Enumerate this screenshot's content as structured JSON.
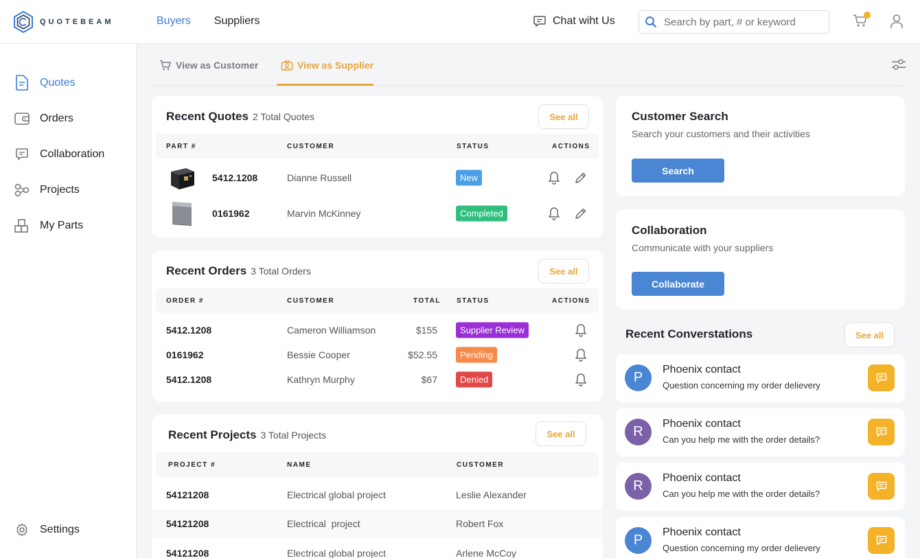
{
  "brand": {
    "name": "QUOTEBEAM"
  },
  "topnav": {
    "buyers": "Buyers",
    "suppliers": "Suppliers"
  },
  "chat": {
    "label": "Chat wiht Us"
  },
  "search": {
    "placeholder": "Search by part, # or keyword"
  },
  "sidebar": {
    "items": [
      {
        "label": "Quotes",
        "icon": "quote-document-icon",
        "active": true
      },
      {
        "label": "Orders",
        "icon": "wallet-icon"
      },
      {
        "label": "Collaboration",
        "icon": "chat-bubble-icon"
      },
      {
        "label": "Projects",
        "icon": "projects-icon"
      },
      {
        "label": "My Parts",
        "icon": "parts-icon"
      }
    ],
    "settings": "Settings"
  },
  "subtabs": {
    "customer": "View as Customer",
    "supplier": "View as Supplier"
  },
  "colors": {
    "accent": "#3f7bd0",
    "orange": "#e8a53b",
    "new": "#4a9fe6",
    "completed": "#2fbf7d",
    "supplier_review": "#9b2fd6",
    "pending": "#f58a4b",
    "denied": "#e04848"
  },
  "quotes": {
    "title": "Recent Quotes",
    "count": "2 Total Quotes",
    "see_all": "See all",
    "headers": {
      "part": "PART #",
      "customer": "CUSTOMER",
      "status": "STATUS",
      "actions": "ACTIONS"
    },
    "rows": [
      {
        "part": "5412.1208",
        "customer": "Dianne Russell",
        "status": "New"
      },
      {
        "part": "0161962",
        "customer": "Marvin McKinney",
        "status": "Completed"
      }
    ]
  },
  "orders": {
    "title": "Recent Orders",
    "count": "3 Total Orders",
    "see_all": "See all",
    "headers": {
      "order": "ORDER #",
      "customer": "CUSTOMER",
      "total": "TOTAL",
      "status": "STATUS",
      "actions": "ACTIONS"
    },
    "rows": [
      {
        "order": "5412.1208",
        "customer": "Cameron Williamson",
        "total": "$155",
        "status": "Supplier Review"
      },
      {
        "order": "0161962",
        "customer": "Bessie Cooper",
        "total": "$52.55",
        "status": "Pending"
      },
      {
        "order": "5412.1208",
        "customer": "Kathryn Murphy",
        "total": "$67",
        "status": "Denied"
      }
    ]
  },
  "projects": {
    "title": "Recent Projects",
    "count": "3 Total Projects",
    "see_all": "See all",
    "headers": {
      "project": "PROJECT #",
      "name": "NAME",
      "customer": "CUSTOMER"
    },
    "rows": [
      {
        "project": "54121208",
        "name": "Electrical global project",
        "customer": "Leslie Alexander"
      },
      {
        "project": "54121208",
        "name": "Electrical  project",
        "customer": "Robert Fox"
      },
      {
        "project": "54121208",
        "name": "Electrical global project",
        "customer": "Arlene McCoy"
      }
    ]
  },
  "customer_search": {
    "title": "Customer Search",
    "subtitle": "Search your customers and their activities",
    "button": "Search"
  },
  "collaboration": {
    "title": "Collaboration",
    "subtitle": "Communicate with your suppliers",
    "button": "Collaborate"
  },
  "conversations": {
    "title": "Recent Converstations",
    "see_all": "See all",
    "items": [
      {
        "initial": "P",
        "name": "Phoenix contact",
        "message": "Question concerning my order delievery",
        "color": "#4a86d4"
      },
      {
        "initial": "R",
        "name": "Phoenix contact",
        "message": "Can you help me with the order details?",
        "color": "#7b62a8"
      },
      {
        "initial": "R",
        "name": "Phoenix contact",
        "message": "Can you help me with the order details?",
        "color": "#7b62a8"
      },
      {
        "initial": "P",
        "name": "Phoenix contact",
        "message": "Question concerning my order delievery",
        "color": "#4a86d4"
      }
    ]
  }
}
